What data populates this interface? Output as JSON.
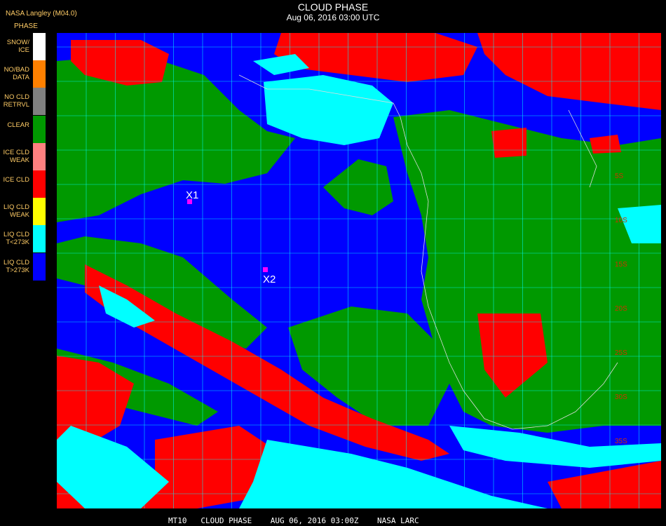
{
  "header": {
    "org": "NASA Langley (M04.0)",
    "title": "CLOUD PHASE",
    "subtitle": "Aug 06, 2016 03:00 UTC"
  },
  "legend": {
    "title": "PHASE",
    "items": [
      {
        "label": "SNOW/\nICE",
        "color": "#ffffff"
      },
      {
        "label": "NO/BAD\nDATA",
        "color": "#ff8000"
      },
      {
        "label": "NO CLD\nRETRVL",
        "color": "#808080"
      },
      {
        "label": "CLEAR",
        "color": "#009900"
      },
      {
        "label": "ICE CLD\nWEAK",
        "color": "#ff8080"
      },
      {
        "label": "ICE CLD",
        "color": "#ff0000"
      },
      {
        "label": "LIQ CLD\nWEAK",
        "color": "#ffff00"
      },
      {
        "label": "LIQ CLD\nT<273K",
        "color": "#00ffff"
      },
      {
        "label": "LIQ CLD\nT>273K",
        "color": "#0000ff"
      }
    ]
  },
  "markers": [
    {
      "label": "X1",
      "color": "#ff00ff"
    },
    {
      "label": "X2",
      "color": "#ff00ff"
    }
  ],
  "lat_labels": [
    "5S",
    "10S",
    "15S",
    "20S",
    "25S",
    "30S",
    "35S"
  ],
  "footer": "MT10   CLOUD PHASE    AUG 06, 2016 03:00Z    NASA LARC"
}
